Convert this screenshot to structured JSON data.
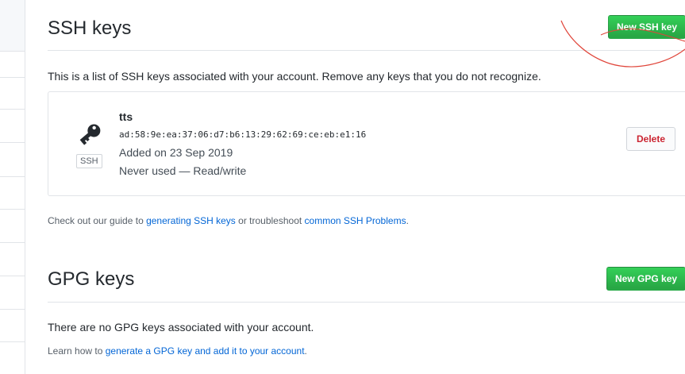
{
  "ssh": {
    "title": "SSH keys",
    "new_button": "New SSH key",
    "description": "This is a list of SSH keys associated with your account. Remove any keys that you do not recognize.",
    "key": {
      "name": "tts",
      "fingerprint": "ad:58:9e:ea:37:06:d7:b6:13:29:62:69:ce:eb:e1:16",
      "added": "Added on 23 Sep 2019",
      "usage": "Never used — Read/write",
      "badge": "SSH",
      "icon": "key-icon",
      "delete_label": "Delete"
    },
    "guide": {
      "prefix": "Check out our guide to ",
      "link1": "generating SSH keys",
      "middle": " or troubleshoot ",
      "link2": "common SSH Problems",
      "suffix": "."
    }
  },
  "gpg": {
    "title": "GPG keys",
    "new_button": "New GPG key",
    "empty_text": "There are no GPG keys associated with your account.",
    "learn": {
      "prefix": "Learn how to ",
      "link": "generate a GPG key and add it to your account",
      "suffix": "."
    }
  },
  "colors": {
    "primary_button": "#28a745",
    "link": "#0366d6",
    "danger": "#cb2431",
    "annotation": "#e0453a"
  }
}
